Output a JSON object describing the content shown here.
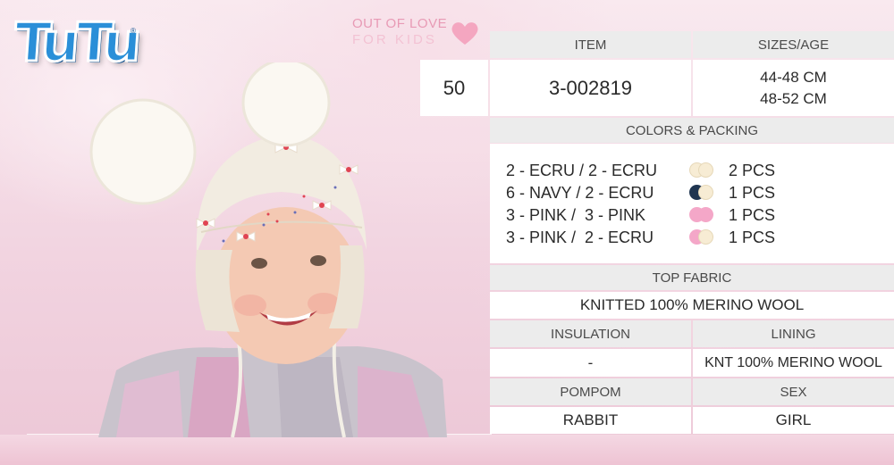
{
  "brand": {
    "logo_text": "TuTu",
    "registered": "®"
  },
  "slogan": {
    "line1": "OUT OF LOVE",
    "line2": "FOR KIDS"
  },
  "item": {
    "number": "50",
    "item_header": "ITEM",
    "item_code": "3-002819",
    "sizes_header": "SIZES/AGE",
    "size_1": "44-48 CM",
    "size_2": "48-52 CM"
  },
  "colors": {
    "header": "COLORS & PACKING",
    "rows": [
      {
        "label": "2 - ECRU / 2 - ECRU",
        "swatch_1": "#f7ecd4",
        "swatch_2": "#f7ecd4",
        "pcs": "2 PCS"
      },
      {
        "label": "6 - NAVY / 2 - ECRU",
        "swatch_1": "#1f3550",
        "swatch_2": "#f7ecd4",
        "pcs": "1 PCS"
      },
      {
        "label": "3 - PINK /  3 - PINK",
        "swatch_1": "#f4a7c8",
        "swatch_2": "#f4a7c8",
        "pcs": "1 PCS"
      },
      {
        "label": "3 - PINK /  2 - ECRU",
        "swatch_1": "#f4a7c8",
        "swatch_2": "#f7ecd4",
        "pcs": "1 PCS"
      }
    ]
  },
  "top_fabric": {
    "header": "TOP FABRIC",
    "value": "KNITTED 100% MERINO WOOL"
  },
  "insulation": {
    "header": "INSULATION",
    "value": "-"
  },
  "lining": {
    "header": "LINING",
    "value": "KNT 100% MERINO WOOL"
  },
  "pompom": {
    "header": "POMPOM",
    "value": "RABBIT"
  },
  "sex": {
    "header": "SEX",
    "value": "GIRL"
  },
  "theme": {
    "brand_blue": "#2a8fd8",
    "slogan_pink": "#e89ab5",
    "header_grey": "#ececec"
  }
}
